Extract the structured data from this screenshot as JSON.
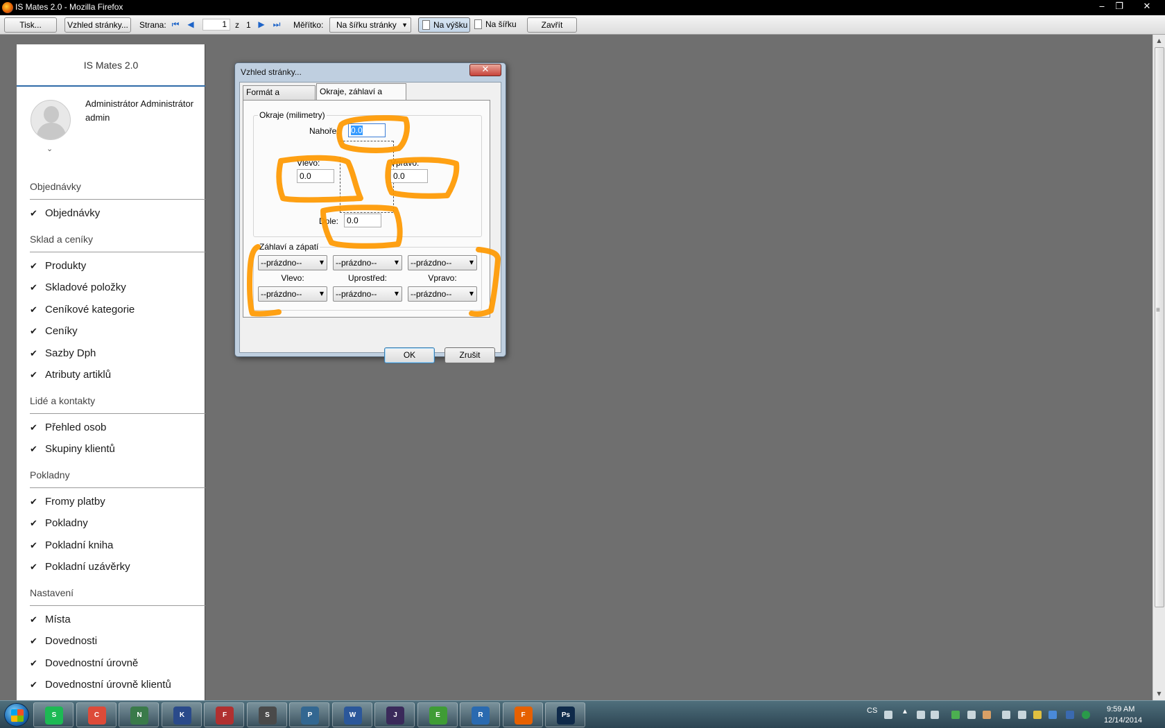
{
  "window": {
    "title": "IS Mates 2.0 - Mozilla Firefox",
    "minimize": "‒",
    "restore": "❐",
    "close": "✕"
  },
  "toolbar": {
    "print": "Tisk...",
    "page_setup": "Vzhled stránky...",
    "page_label": "Strana:",
    "page_value": "1",
    "of_label": "z",
    "page_total": "1",
    "first": "⏮",
    "prev": "◀",
    "next": "▶",
    "last": "⏭",
    "scale_label": "Měřítko:",
    "scale_value": "Na šířku stránky",
    "portrait": "Na výšku",
    "landscape": "Na šířku",
    "close": "Zavřít"
  },
  "sheet": {
    "brand": "IS Mates 2.0",
    "user_name": "Administrátor Administrátor",
    "user_login": "admin",
    "chevron": "⌄",
    "check_glyph": "✔",
    "sections": [
      {
        "title": "Objednávky",
        "items": [
          "Objednávky"
        ]
      },
      {
        "title": "Sklad a ceníky",
        "items": [
          "Produkty",
          "Skladové položky",
          "Ceníkové kategorie",
          "Ceníky",
          "Sazby Dph",
          "Atributy artiklů"
        ]
      },
      {
        "title": "Lidé a kontakty",
        "items": [
          "Přehled osob",
          "Skupiny klientů"
        ]
      },
      {
        "title": "Pokladny",
        "items": [
          "Fromy platby",
          "Pokladny",
          "Pokladní kniha",
          "Pokladní uzávěrky"
        ]
      },
      {
        "title": "Nastavení",
        "items": [
          "Místa",
          "Dovednosti",
          "Dovednostní úrovně",
          "Dovednostní úrovně klientů"
        ]
      }
    ]
  },
  "dialog": {
    "title": "Vzhled stránky...",
    "close": "✕",
    "tabs": [
      "Formát a možnosti",
      "Okraje, záhlaví a zápatí"
    ],
    "active_tab": 1,
    "margins": {
      "group_label": "Okraje (milimetry)",
      "top_label": "Nahoře:",
      "top_value": "0.0",
      "left_label": "Vlevo:",
      "left_value": "0.0",
      "right_label": "Vpravo:",
      "right_value": "0.0",
      "bottom_label": "Dole:",
      "bottom_value": "0.0"
    },
    "header_footer": {
      "group_label": "Záhlaví a zápatí",
      "header_values": [
        "--prázdno--",
        "--prázdno--",
        "--prázdno--"
      ],
      "column_labels": [
        "Vlevo:",
        "Uprostřed:",
        "Vpravo:"
      ],
      "footer_values": [
        "--prázdno--",
        "--prázdno--",
        "--prázdno--"
      ]
    },
    "ok": "OK",
    "cancel": "Zrušit"
  },
  "taskbar": {
    "apps": [
      {
        "name": "Spotify",
        "color": "#1db954",
        "glyph": "S"
      },
      {
        "name": "Chrome",
        "color": "#dd4b39",
        "glyph": "C"
      },
      {
        "name": "Network",
        "color": "#3a7a4a",
        "glyph": "N"
      },
      {
        "name": "KeePass",
        "color": "#2a4a8a",
        "glyph": "K"
      },
      {
        "name": "Save",
        "color": "#b03030",
        "glyph": "F"
      },
      {
        "name": "Sublime",
        "color": "#4a4a4a",
        "glyph": "S"
      },
      {
        "name": "PostgreSQL",
        "color": "#336791",
        "glyph": "P"
      },
      {
        "name": "Word",
        "color": "#2b579a",
        "glyph": "W"
      },
      {
        "name": "Java EE IDE",
        "color": "#3a2a5a",
        "glyph": "J"
      },
      {
        "name": "Evernote",
        "color": "#3f9c35",
        "glyph": "E"
      },
      {
        "name": "Remote Desktop",
        "color": "#2a6ab0",
        "glyph": "R"
      },
      {
        "name": "Firefox",
        "color": "#e66000",
        "glyph": "F"
      },
      {
        "name": "Photoshop",
        "color": "#0f2a4a",
        "glyph": "Ps"
      }
    ],
    "lang": "CS",
    "time": "9:59 AM",
    "date": "12/14/2014"
  },
  "colors": {
    "annotation": "#ff9900",
    "brand_line": "#2f6aa8",
    "background": "#6f6f6f"
  }
}
